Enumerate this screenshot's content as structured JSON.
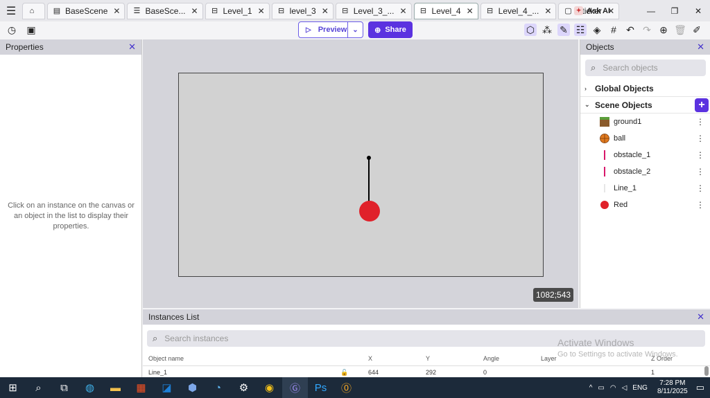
{
  "tabs": [
    {
      "label": "",
      "icon": "home-icon"
    },
    {
      "label": "BaseScene",
      "icon": "scene-icon"
    },
    {
      "label": "BaseSce...",
      "icon": "external-layout-icon"
    },
    {
      "label": "Level_1",
      "icon": "scene-icon"
    },
    {
      "label": "level_3",
      "icon": "scene-icon"
    },
    {
      "label": "Level_3_...",
      "icon": "scene-icon"
    },
    {
      "label": "Level_4",
      "icon": "scene-icon",
      "active": true
    },
    {
      "label": "Level_4_...",
      "icon": "scene-icon"
    },
    {
      "label": "Sticker",
      "icon": "object-icon"
    }
  ],
  "ask_ai": "Ask AI",
  "toolbar": {
    "preview_label": "Preview",
    "share_label": "Share"
  },
  "properties": {
    "title": "Properties",
    "hint": "Click on an instance on the canvas or an object in the list to display their properties."
  },
  "scene": {
    "coordinates": "1082;543"
  },
  "objects_panel": {
    "title": "Objects",
    "search_placeholder": "Search objects",
    "global_label": "Global Objects",
    "scene_label": "Scene Objects",
    "items": [
      {
        "name": "ground1",
        "icon": "ground-icon"
      },
      {
        "name": "ball",
        "icon": "basketball-icon"
      },
      {
        "name": "obstacle_1",
        "icon": "obstacle-icon"
      },
      {
        "name": "obstacle_2",
        "icon": "obstacle-icon"
      },
      {
        "name": "Line_1",
        "icon": "line-icon"
      },
      {
        "name": "Red",
        "icon": "red-circle-icon"
      }
    ]
  },
  "instances": {
    "title": "Instances List",
    "search_placeholder": "Search instances",
    "columns": [
      "Object name",
      "X",
      "Y",
      "Angle",
      "Layer",
      "Z Order"
    ],
    "rows": [
      {
        "name": "Line_1",
        "x": "644",
        "y": "292",
        "angle": "0",
        "layer": "",
        "z": "1"
      }
    ]
  },
  "watermark": {
    "line1": "Activate Windows",
    "line2": "Go to Settings to activate Windows."
  },
  "taskbar": {
    "lang": "ENG",
    "time": "7:28 PM",
    "date": "8/11/2025"
  },
  "colors": {
    "accent": "#5b32e0",
    "red_circle": "#e0212a"
  }
}
